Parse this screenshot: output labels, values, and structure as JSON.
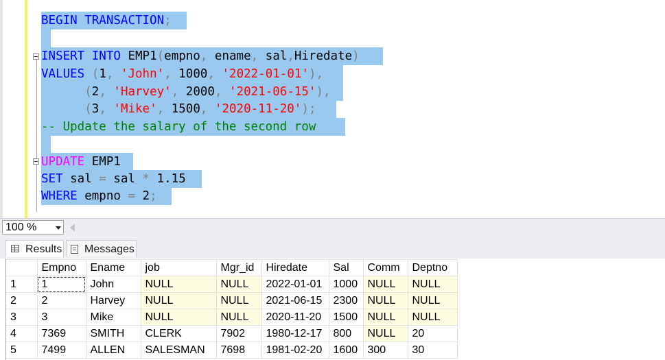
{
  "editor": {
    "lines": [
      {
        "tokens": [
          {
            "t": "BEGIN",
            "c": "kw"
          },
          {
            "t": " ",
            "c": ""
          },
          {
            "t": "TRANSACTION",
            "c": "kw"
          },
          {
            "t": ";",
            "c": "op"
          },
          {
            "t": "  ",
            "c": ""
          }
        ]
      },
      {
        "tokens": []
      },
      {
        "tokens": [
          {
            "t": "INSERT",
            "c": "kw"
          },
          {
            "t": " ",
            "c": ""
          },
          {
            "t": "INTO",
            "c": "kw"
          },
          {
            "t": " EMP1",
            "c": ""
          },
          {
            "t": "(",
            "c": "op"
          },
          {
            "t": "empno",
            "c": ""
          },
          {
            "t": ",",
            "c": "op"
          },
          {
            "t": " ename",
            "c": ""
          },
          {
            "t": ",",
            "c": "op"
          },
          {
            "t": " sal",
            "c": ""
          },
          {
            "t": ",",
            "c": "op"
          },
          {
            "t": "Hiredate",
            "c": ""
          },
          {
            "t": ")",
            "c": "op"
          },
          {
            "t": " ",
            "c": ""
          }
        ]
      },
      {
        "tokens": [
          {
            "t": "VALUES",
            "c": "kw"
          },
          {
            "t": " ",
            "c": ""
          },
          {
            "t": "(",
            "c": "op"
          },
          {
            "t": "1",
            "c": ""
          },
          {
            "t": ",",
            "c": "op"
          },
          {
            "t": " ",
            "c": ""
          },
          {
            "t": "'John'",
            "c": "str"
          },
          {
            "t": ",",
            "c": "op"
          },
          {
            "t": " 1000",
            "c": ""
          },
          {
            "t": ",",
            "c": "op"
          },
          {
            "t": " ",
            "c": ""
          },
          {
            "t": "'2022-01-01'",
            "c": "str"
          },
          {
            "t": ")",
            "c": "op"
          },
          {
            "t": ",",
            "c": "op"
          },
          {
            "t": " ",
            "c": ""
          }
        ]
      },
      {
        "tokens": [
          {
            "t": "      ",
            "c": ""
          },
          {
            "t": "(",
            "c": "op"
          },
          {
            "t": "2",
            "c": ""
          },
          {
            "t": ",",
            "c": "op"
          },
          {
            "t": " ",
            "c": ""
          },
          {
            "t": "'Harvey'",
            "c": "str"
          },
          {
            "t": ",",
            "c": "op"
          },
          {
            "t": " 2000",
            "c": ""
          },
          {
            "t": ",",
            "c": "op"
          },
          {
            "t": " ",
            "c": ""
          },
          {
            "t": "'2021-06-15'",
            "c": "str"
          },
          {
            "t": ")",
            "c": "op"
          },
          {
            "t": ",",
            "c": "op"
          },
          {
            "t": " ",
            "c": ""
          }
        ]
      },
      {
        "tokens": [
          {
            "t": "      ",
            "c": ""
          },
          {
            "t": "(",
            "c": "op"
          },
          {
            "t": "3",
            "c": ""
          },
          {
            "t": ",",
            "c": "op"
          },
          {
            "t": " ",
            "c": ""
          },
          {
            "t": "'Mike'",
            "c": "str"
          },
          {
            "t": ",",
            "c": "op"
          },
          {
            "t": " 1500",
            "c": ""
          },
          {
            "t": ",",
            "c": "op"
          },
          {
            "t": " ",
            "c": ""
          },
          {
            "t": "'2020-11-20'",
            "c": "str"
          },
          {
            "t": ")",
            "c": "op"
          },
          {
            "t": ";",
            "c": "op"
          },
          {
            "t": " ",
            "c": ""
          }
        ]
      },
      {
        "tokens": [
          {
            "t": "-- Update the salary of the second row ",
            "c": "cm"
          },
          {
            "t": " ",
            "c": ""
          }
        ]
      },
      {
        "tokens": []
      },
      {
        "tokens": [
          {
            "t": "UPDATE",
            "c": "fn"
          },
          {
            "t": " EMP1 ",
            "c": ""
          }
        ]
      },
      {
        "tokens": [
          {
            "t": "SET",
            "c": "kw"
          },
          {
            "t": " sal ",
            "c": ""
          },
          {
            "t": "=",
            "c": "op"
          },
          {
            "t": " sal ",
            "c": ""
          },
          {
            "t": "*",
            "c": "op"
          },
          {
            "t": " 1.15 ",
            "c": ""
          }
        ]
      },
      {
        "tokens": [
          {
            "t": "WHERE",
            "c": "kw"
          },
          {
            "t": " empno ",
            "c": ""
          },
          {
            "t": "=",
            "c": "op"
          },
          {
            "t": " 2",
            "c": ""
          },
          {
            "t": ";",
            "c": "op"
          },
          {
            "t": " ",
            "c": ""
          }
        ]
      }
    ]
  },
  "zoom": {
    "value": "100 %"
  },
  "tabs": {
    "results": "Results",
    "messages": "Messages"
  },
  "grid": {
    "columns": [
      "Empno",
      "Ename",
      "job",
      "Mgr_id",
      "Hiredate",
      "Sal",
      "Comm",
      "Deptno"
    ],
    "rows": [
      {
        "num": "1",
        "cells": [
          "1",
          "John",
          "NULL",
          "NULL",
          "2022-01-01",
          "1000",
          "NULL",
          "NULL"
        ]
      },
      {
        "num": "2",
        "cells": [
          "2",
          "Harvey",
          "NULL",
          "NULL",
          "2021-06-15",
          "2300",
          "NULL",
          "NULL"
        ]
      },
      {
        "num": "3",
        "cells": [
          "3",
          "Mike",
          "NULL",
          "NULL",
          "2020-11-20",
          "1500",
          "NULL",
          "NULL"
        ]
      },
      {
        "num": "4",
        "cells": [
          "7369",
          "SMITH",
          "CLERK",
          "7902",
          "1980-12-17",
          "800",
          "NULL",
          "20"
        ]
      },
      {
        "num": "5",
        "cells": [
          "7499",
          "ALLEN",
          "SALESMAN",
          "7698",
          "1981-02-20",
          "1600",
          "300",
          "30"
        ]
      }
    ]
  }
}
